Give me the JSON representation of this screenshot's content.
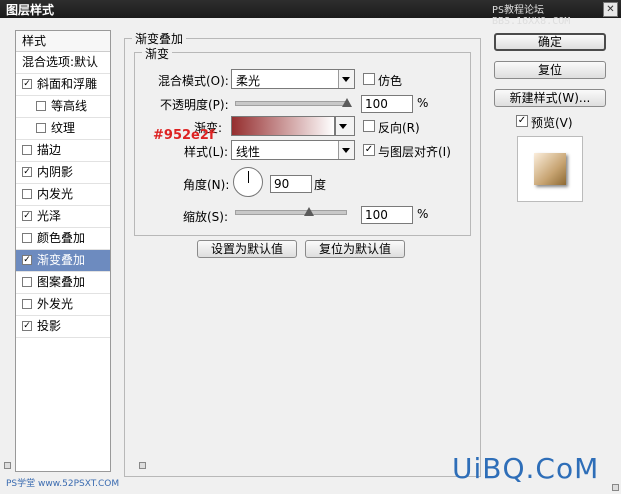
{
  "window": {
    "title": "图层样式",
    "watermark": "PS教程论坛 BBS.16XX8.COM"
  },
  "sidebar": {
    "header": "样式",
    "items": [
      {
        "label": "混合选项:默认",
        "checkbox": false,
        "checked": false,
        "indent": 0,
        "selected": false
      },
      {
        "label": "斜面和浮雕",
        "checkbox": true,
        "checked": true,
        "indent": 0,
        "selected": false
      },
      {
        "label": "等高线",
        "checkbox": true,
        "checked": false,
        "indent": 1,
        "selected": false
      },
      {
        "label": "纹理",
        "checkbox": true,
        "checked": false,
        "indent": 1,
        "selected": false
      },
      {
        "label": "描边",
        "checkbox": true,
        "checked": false,
        "indent": 0,
        "selected": false
      },
      {
        "label": "内阴影",
        "checkbox": true,
        "checked": true,
        "indent": 0,
        "selected": false
      },
      {
        "label": "内发光",
        "checkbox": true,
        "checked": false,
        "indent": 0,
        "selected": false
      },
      {
        "label": "光泽",
        "checkbox": true,
        "checked": true,
        "indent": 0,
        "selected": false
      },
      {
        "label": "颜色叠加",
        "checkbox": true,
        "checked": false,
        "indent": 0,
        "selected": false
      },
      {
        "label": "渐变叠加",
        "checkbox": true,
        "checked": true,
        "indent": 0,
        "selected": true
      },
      {
        "label": "图案叠加",
        "checkbox": true,
        "checked": false,
        "indent": 0,
        "selected": false
      },
      {
        "label": "外发光",
        "checkbox": true,
        "checked": false,
        "indent": 0,
        "selected": false
      },
      {
        "label": "投影",
        "checkbox": true,
        "checked": true,
        "indent": 0,
        "selected": false
      }
    ]
  },
  "panel": {
    "title": "渐变叠加",
    "group_title": "渐变",
    "blend_mode": {
      "label": "混合模式(O):",
      "value": "柔光"
    },
    "dither": {
      "label": "仿色",
      "checked": false
    },
    "opacity": {
      "label": "不透明度(P):",
      "value": "100",
      "unit": "%",
      "level": 1.0
    },
    "gradient": {
      "label": "渐变:",
      "color_from": "#952e2f",
      "color_to": "#ffffff"
    },
    "reverse": {
      "label": "反向(R)",
      "checked": false
    },
    "hex_note": "#952e2f",
    "style": {
      "label": "样式(L):",
      "value": "线性"
    },
    "align": {
      "label": "与图层对齐(I)",
      "checked": true
    },
    "angle": {
      "label": "角度(N):",
      "value": "90",
      "unit": "度"
    },
    "scale": {
      "label": "缩放(S):",
      "value": "100",
      "unit": "%",
      "level": 0.67
    },
    "make_default": "设置为默认值",
    "reset_default": "复位为默认值"
  },
  "actions": {
    "ok": "确定",
    "reset": "复位",
    "new_style": "新建样式(W)...",
    "preview": {
      "label": "预览(V)",
      "checked": true
    }
  },
  "footer": {
    "left_watermark": "PS学堂 www.52PSXT.COM",
    "right_watermark": "UiBQ.CoM"
  },
  "colors": {
    "selection": "#6d8bbf",
    "hex_note": "#dd2222",
    "watermark": "#2e6eb8"
  }
}
